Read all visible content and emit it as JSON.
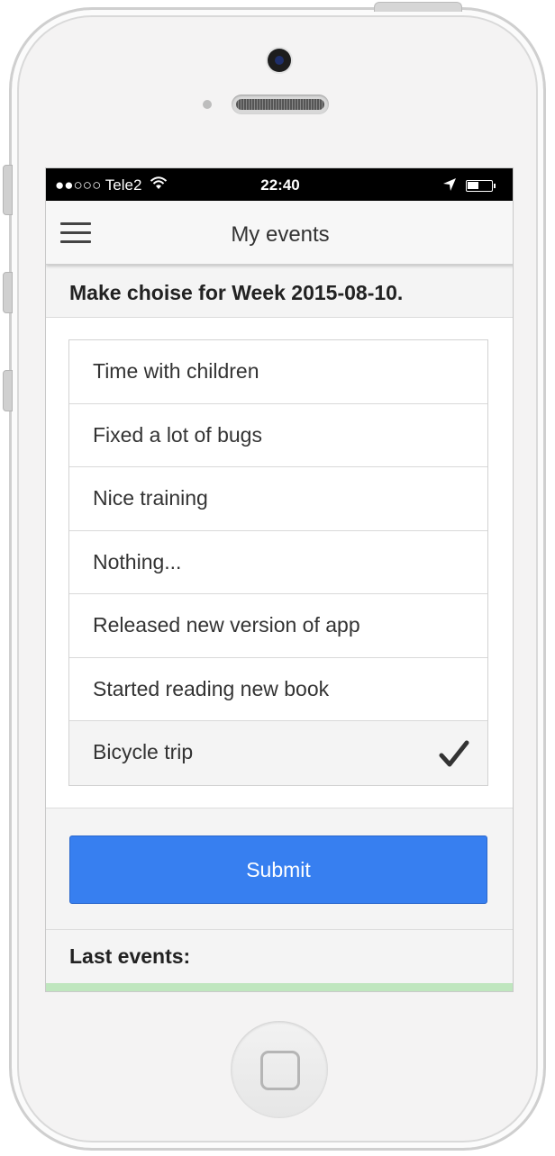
{
  "status_bar": {
    "carrier": "●●○○○ Tele2",
    "time": "22:40"
  },
  "nav": {
    "title": "My events"
  },
  "week_header": "Make choise for Week 2015-08-10.",
  "events": [
    {
      "label": "Time with children",
      "selected": false
    },
    {
      "label": "Fixed a lot of bugs",
      "selected": false
    },
    {
      "label": "Nice training",
      "selected": false
    },
    {
      "label": "Nothing...",
      "selected": false
    },
    {
      "label": "Released new version of app",
      "selected": false
    },
    {
      "label": "Started reading new book",
      "selected": false
    },
    {
      "label": "Bicycle trip",
      "selected": true
    }
  ],
  "submit_label": "Submit",
  "last_events_header": "Last events:",
  "colors": {
    "submit": "#377ff0",
    "selected_row": "#f4f4f4",
    "status_bar": "#000000"
  }
}
